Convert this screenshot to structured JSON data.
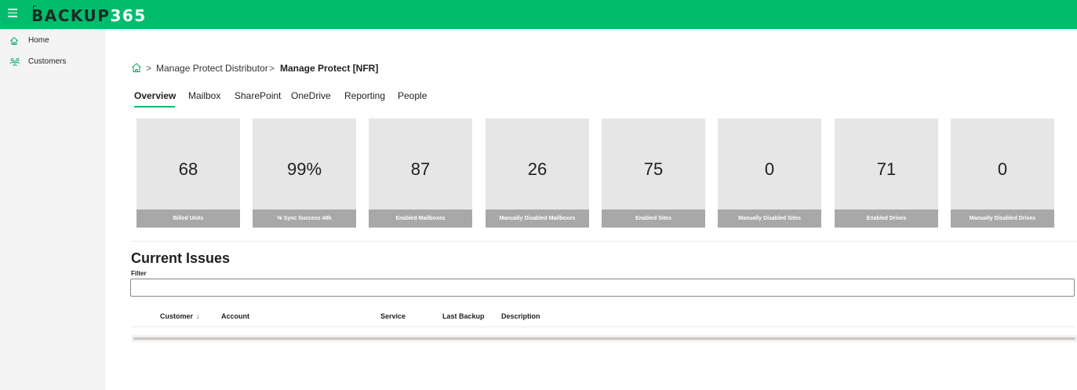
{
  "app": {
    "logo_part1": "BACKUP",
    "logo_part2": "365"
  },
  "sidebar": {
    "items": [
      {
        "label": "Home",
        "icon": "home-icon"
      },
      {
        "label": "Customers",
        "icon": "customers-icon"
      }
    ]
  },
  "breadcrumb": {
    "items": [
      "Manage Protect Distributor",
      "Manage Protect [NFR]"
    ],
    "separator": ">"
  },
  "tabs": [
    {
      "label": "Overview",
      "active": true
    },
    {
      "label": "Mailbox",
      "active": false
    },
    {
      "label": "SharePoint",
      "active": false
    },
    {
      "label": "OneDrive",
      "active": false
    },
    {
      "label": "Reporting",
      "active": false
    },
    {
      "label": "People",
      "active": false
    }
  ],
  "stats": [
    {
      "value": "68",
      "label": "Billed Units"
    },
    {
      "value": "99%",
      "label": "% Sync Success 48h"
    },
    {
      "value": "87",
      "label": "Enabled Mailboxes"
    },
    {
      "value": "26",
      "label": "Manually Disabled Mailboxes"
    },
    {
      "value": "75",
      "label": "Enabled Sites"
    },
    {
      "value": "0",
      "label": "Manually Disabled Sites"
    },
    {
      "value": "71",
      "label": "Enabled Drives"
    },
    {
      "value": "0",
      "label": "Manually Disabled Drives"
    }
  ],
  "issues": {
    "title": "Current Issues",
    "filter_label": "Filter",
    "filter_value": "",
    "columns": [
      "Customer",
      "Account",
      "Service",
      "Last Backup",
      "Description"
    ],
    "sort_indicator": "↓"
  },
  "colors": {
    "brand_green": "#00bd6d",
    "card_bg": "#e6e6e6",
    "card_label_bg": "#a8a8a8",
    "sidebar_bg": "#f4f4f4"
  }
}
